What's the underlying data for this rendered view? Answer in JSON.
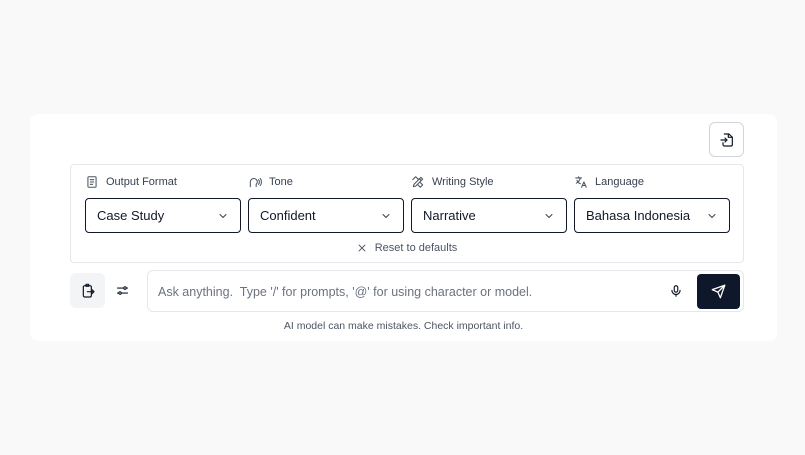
{
  "toolbar": {
    "export_icon": "file-export-icon"
  },
  "settings": [
    {
      "key": "output_format",
      "label": "Output Format",
      "icon": "book-icon",
      "value": "Case Study"
    },
    {
      "key": "tone",
      "label": "Tone",
      "icon": "speaking-head-icon",
      "value": "Confident"
    },
    {
      "key": "writing_style",
      "label": "Writing Style",
      "icon": "pencil-ruler-icon",
      "value": "Narrative"
    },
    {
      "key": "language",
      "label": "Language",
      "icon": "translate-icon",
      "value": "Bahasa Indonesia"
    }
  ],
  "reset_label": "Reset to defaults",
  "chat": {
    "placeholder": "Ask anything.  Type '/' for prompts, '@' for using character or model.",
    "value": ""
  },
  "disclaimer": "AI model can make mistakes. Check important info."
}
